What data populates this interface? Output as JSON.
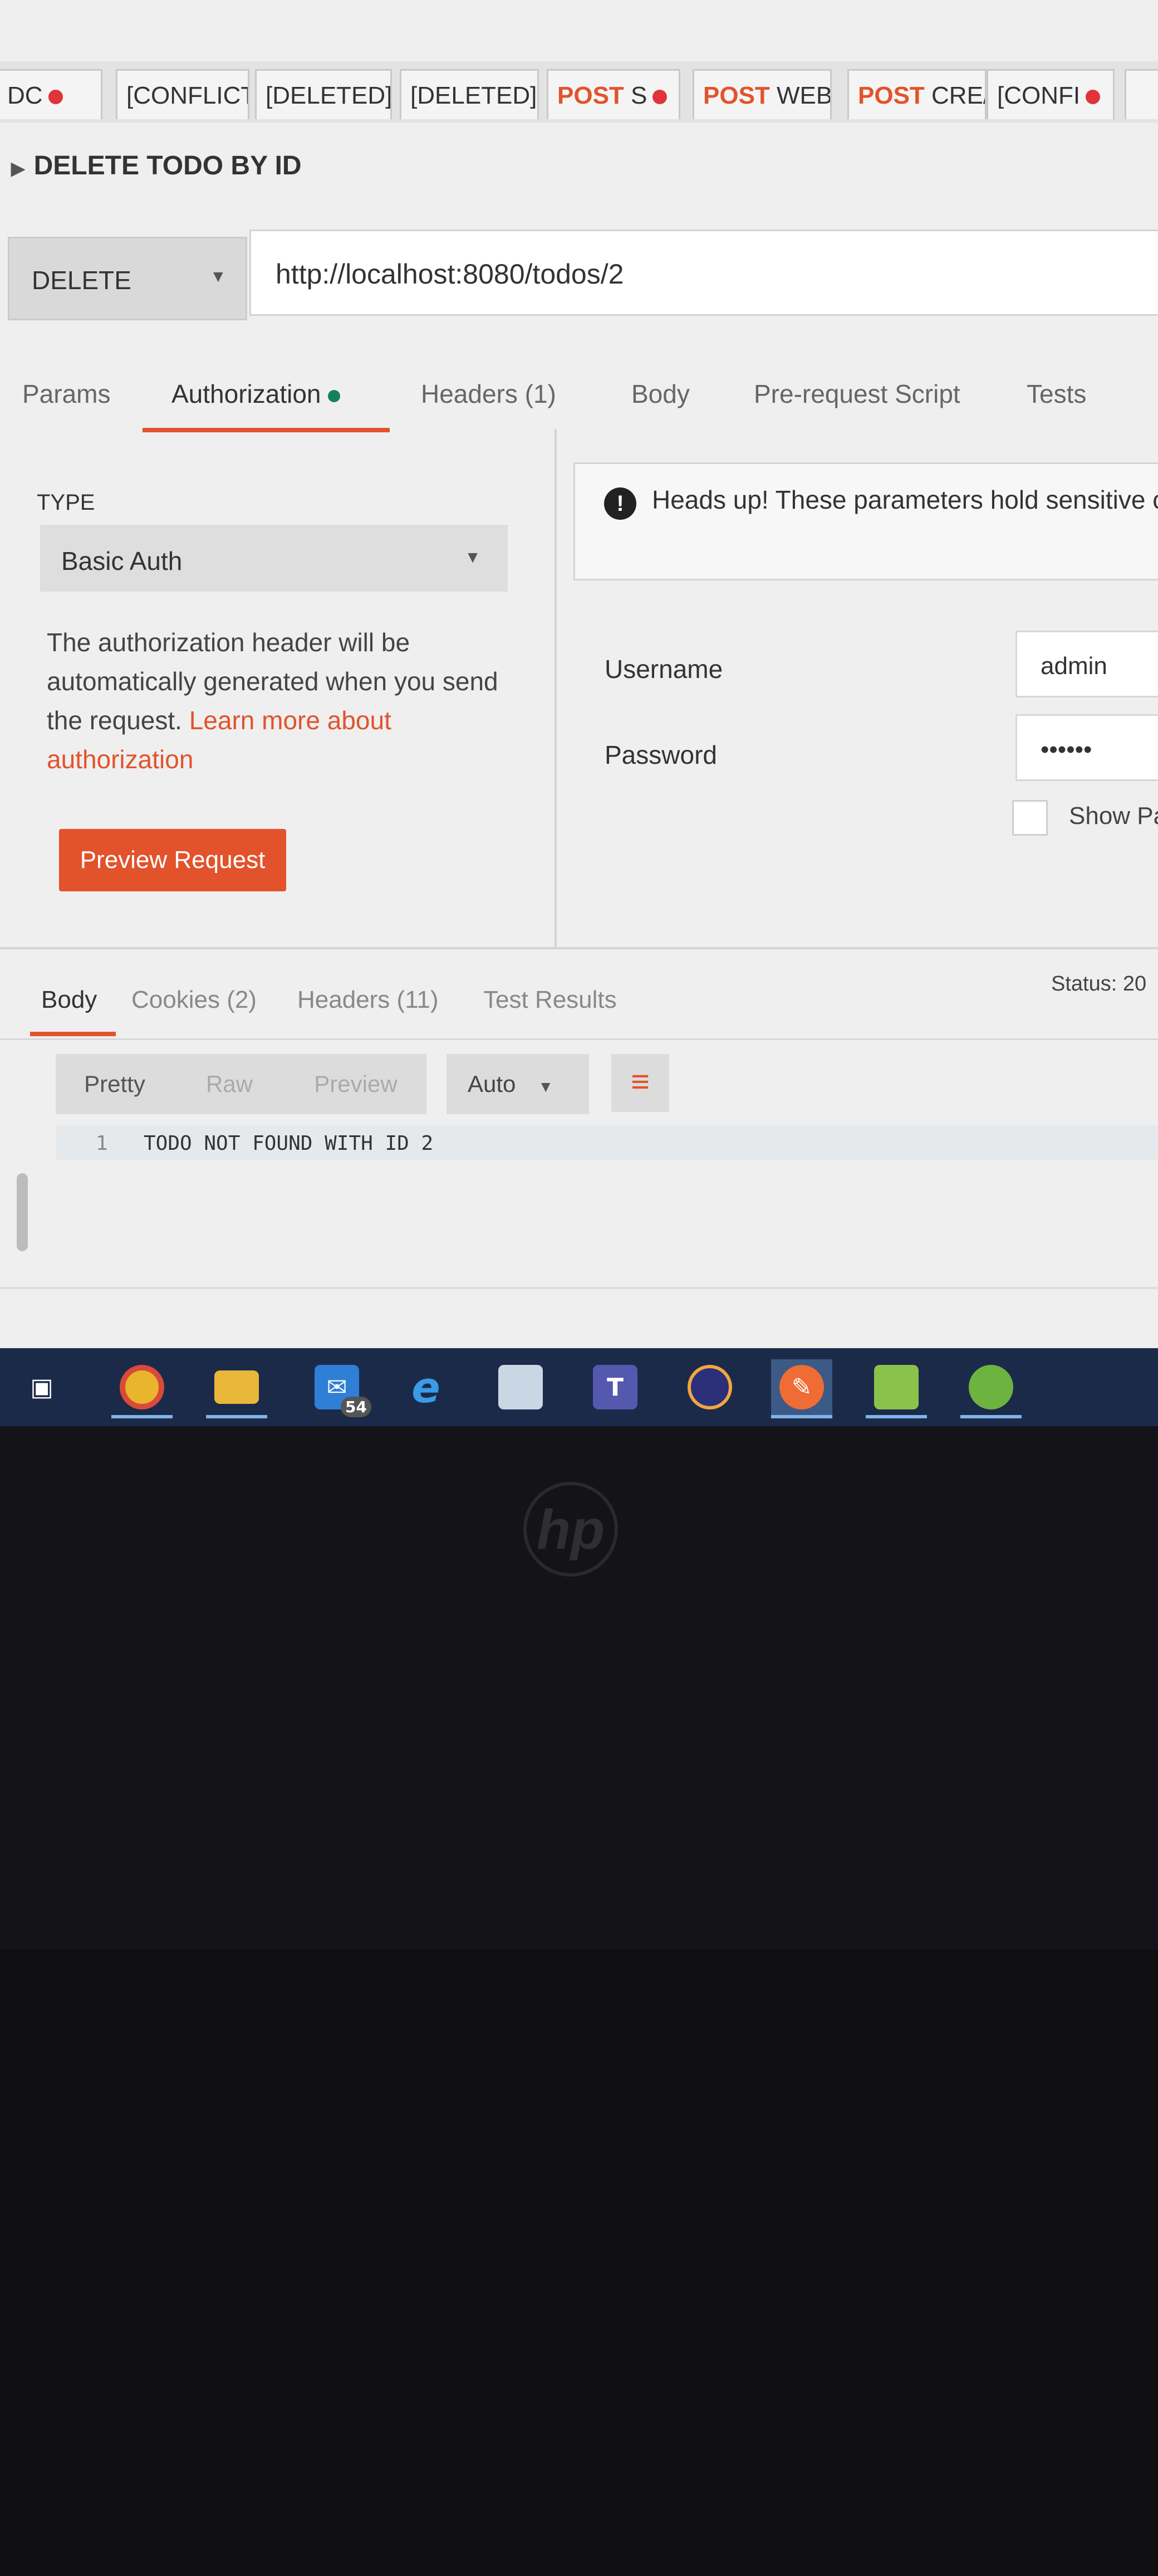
{
  "tabs": [
    {
      "method": "",
      "label": "DC",
      "dot": true
    },
    {
      "method": "",
      "label": "[CONFLICT",
      "dot": false
    },
    {
      "method": "",
      "label": "[DELETED]",
      "dot": false
    },
    {
      "method": "",
      "label": "[DELETED]",
      "dot": false
    },
    {
      "method": "POST",
      "label": "S",
      "dot": true
    },
    {
      "method": "POST",
      "label": "WEB",
      "dot": false
    },
    {
      "method": "POST",
      "label": "CRE/",
      "dot": false
    },
    {
      "method": "",
      "label": "[CONFI",
      "dot": true
    }
  ],
  "request": {
    "name": "DELETE TODO BY ID",
    "method": "DELETE",
    "url": "http://localhost:8080/todos/2"
  },
  "request_tabs": {
    "params": "Params",
    "authorization": "Authorization",
    "headers": "Headers (1)",
    "body": "Body",
    "prerequest": "Pre-request Script",
    "tests": "Tests"
  },
  "auth": {
    "type_label": "TYPE",
    "type_value": "Basic Auth",
    "description": "The authorization header will be automatically generated when you send the request.",
    "learn_more": "Learn more about authorization",
    "preview_button": "Preview Request",
    "notice": "Heads up! These parameters hold sensitive collaborative environment, we recommend",
    "username_label": "Username",
    "username_value": "admin",
    "password_label": "Password",
    "password_value": "••••••",
    "show_password_label": "Show Pa"
  },
  "response": {
    "tabs": {
      "body": "Body",
      "cookies": "Cookies (2)",
      "headers": "Headers (11)",
      "test_results": "Test Results"
    },
    "status": "Status: 20",
    "view_modes": {
      "pretty": "Pretty",
      "raw": "Raw",
      "preview": "Preview"
    },
    "format": "Auto",
    "line_number": "1",
    "body_text": "TODO NOT FOUND WITH ID 2"
  },
  "taskbar": {
    "apps": [
      "task-view",
      "chrome",
      "file-explorer",
      "outlook",
      "internet-explorer",
      "photos",
      "teams",
      "eclipse",
      "postman",
      "notepad",
      "spring-tool-suite"
    ],
    "outlook_badge": "54"
  },
  "colors": {
    "accent": "#e2532c",
    "green": "#16805a",
    "taskbar": "#1c2a4a"
  }
}
